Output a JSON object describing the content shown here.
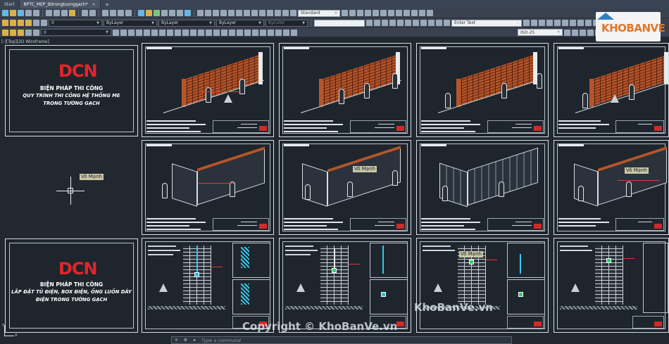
{
  "tabs": [
    {
      "label": "Start",
      "active": false
    },
    {
      "label": "BPTC_MEP_tbtrongtuonggach*",
      "active": true
    }
  ],
  "toolbar": {
    "text_style": "Standard",
    "layer": "0",
    "color": "ByLayer",
    "linetype": "ByLayer",
    "lineweight": "ByLayer",
    "plot_style": "ByColor",
    "search_placeholder": "Enter Text",
    "dim_style": "ISO-25"
  },
  "viewport_label": "[-][Top][2D Wireframe]",
  "covers": [
    {
      "logo": "DCN",
      "title": "BIỆN PHÁP THI CÔNG",
      "subtitle_1": "QUY TRÌNH THI CÔNG HỆ THỐNG ME",
      "subtitle_2": "TRONG TƯỜNG GẠCH"
    },
    {
      "logo": "DCN",
      "title": "BIỆN PHÁP THI CÔNG",
      "subtitle_1": "LẮP ĐẶT TỦ ĐIỆN, BOX ĐIỆN, ỐNG LUỒN DÂY",
      "subtitle_2": "ĐIỆN TRONG TƯỜNG GẠCH"
    }
  ],
  "tooltip_tags": {
    "crosshair": "Võ Mạnh",
    "sheet_row2_b": "Võ Mạnh",
    "sheet_row2_d": "Võ Mạnh",
    "sheet_row3_c": "Võ Mạnh"
  },
  "watermarks": {
    "site": "KhoBanVe.vn",
    "copyright": "Copyright © KhoBanVe.vn"
  },
  "logo_text": "KHOBANVE",
  "command_line": {
    "placeholder": "Type a command"
  },
  "ucs": {
    "x": "X",
    "y": "Y"
  }
}
